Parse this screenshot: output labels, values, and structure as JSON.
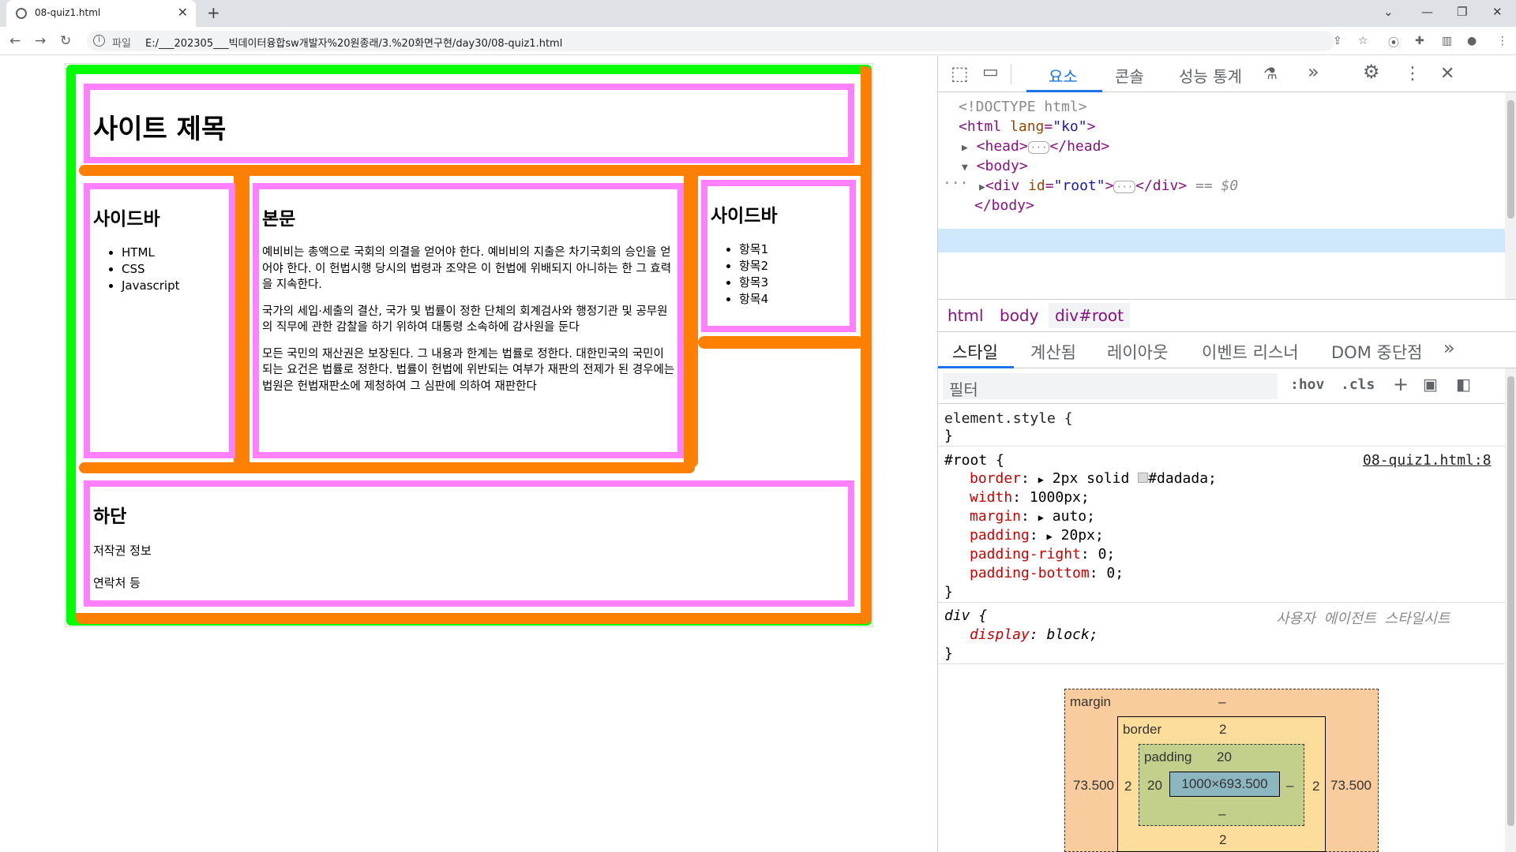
{
  "browser": {
    "tab_title": "08-quiz1.html",
    "file_label": "파일",
    "url": "E:/___202305___빅데이터융합sw개발자%20원종래/3.%20화면구현/day30/08-quiz1.html"
  },
  "page": {
    "header_title": "사이트 제목",
    "sidebar_left": {
      "title": "사이드바",
      "items": [
        "HTML",
        "CSS",
        "Javascript"
      ]
    },
    "main": {
      "title": "본문",
      "paragraphs": [
        "예비비는 총액으로 국회의 의결을 얻어야 한다. 예비비의 지출은 차기국회의 승인을 얻어야 한다. 이 헌법시행 당시의 법령과 조약은 이 헌법에 위배되지 아니하는 한 그 효력을 지속한다.",
        "국가의 세입·세출의 결산, 국가 및 법률이 정한 단체의 회계검사와 행정기관 및 공무원의 직무에 관한 감찰을 하기 위하여 대통령 소속하에 감사원을 둔다",
        "모든 국민의 재산권은 보장된다. 그 내용과 한계는 법률로 정한다. 대한민국의 국민이 되는 요건은 법률로 정한다. 법률이 헌법에 위반되는 여부가 재판의 전제가 된 경우에는 법원은 헌법재판소에 제청하여 그 심판에 의하여 재판한다"
      ]
    },
    "sidebar_right": {
      "title": "사이드바",
      "items": [
        "항목1",
        "항목2",
        "항목3",
        "항목4"
      ]
    },
    "footer": {
      "title": "하단",
      "lines": [
        "저작권 정보",
        "연락처 등"
      ]
    }
  },
  "devtools": {
    "tabs": [
      "요소",
      "콘솔",
      "성능 통계",
      "»"
    ],
    "dom": {
      "doctype": "<!DOCTYPE html>",
      "html_open": "<html",
      "lang_attr": "lang",
      "lang_val": "\"ko\"",
      "close": ">",
      "head": "<head>",
      "ellipsis": "···",
      "head_close": "</head>",
      "body": "<body>",
      "div_open": "<div",
      "id_attr": "id",
      "id_val": "\"root\"",
      "div_close": "</div>",
      "eq": "== $0",
      "body_close": "</body>",
      "dots": "···"
    },
    "breadcrumbs": [
      "html",
      "body",
      "div#root"
    ],
    "style_tabs": [
      "스타일",
      "계산됨",
      "레이아웃",
      "이벤트 리스너",
      "DOM 중단점",
      "»"
    ],
    "filter_placeholder": "필터",
    "hov": ":hov",
    "cls": ".cls",
    "rules": {
      "element_style": "element.style {",
      "close_brace": "}",
      "root_sel": "#root {",
      "root_src": "08-quiz1.html:8",
      "props": [
        {
          "n": "border",
          "v": "2px solid",
          "extra": "#dadada;"
        },
        {
          "n": "width",
          "v": "1000px;"
        },
        {
          "n": "margin",
          "v": "auto;"
        },
        {
          "n": "padding",
          "v": "20px;"
        },
        {
          "n": "padding-right",
          "v": "0;"
        },
        {
          "n": "padding-bottom",
          "v": "0;"
        }
      ],
      "div_sel": "div {",
      "ua": "사용자 에이전트 스타일시트",
      "display_n": "display",
      "display_v": "block;"
    },
    "boxmodel": {
      "margin_label": "margin",
      "margin_top": "–",
      "margin_left": "73.500",
      "margin_right": "73.500",
      "border_label": "border",
      "border_top": "2",
      "border_left": "2",
      "border_right": "2",
      "border_bottom": "2",
      "padding_label": "padding",
      "padding_top": "20",
      "padding_left": "20",
      "padding_right": "–",
      "padding_bottom": "–",
      "content": "1000×693.500"
    },
    "colors": {
      "swatch": "#dadada",
      "green": "#00ff00",
      "orange": "#ff8000",
      "pink": "#ff80ff"
    }
  }
}
